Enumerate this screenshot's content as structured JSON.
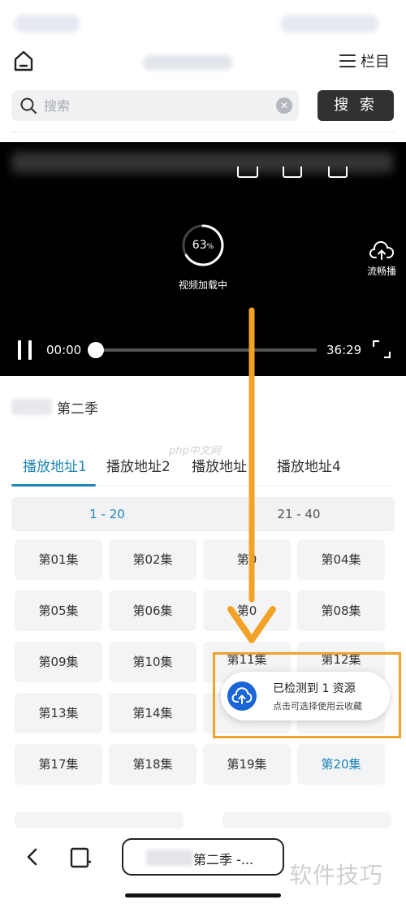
{
  "header": {
    "menu_label": "栏目"
  },
  "search": {
    "placeholder": "搜索",
    "button_label": "搜 索"
  },
  "player": {
    "progress_percent": "63",
    "percent_sign": "%",
    "loading_text": "视频加载中",
    "smooth_label": "流畅播",
    "current_time": "00:00",
    "total_time": "36:29"
  },
  "show": {
    "season": "第二季"
  },
  "source_tabs": [
    {
      "label": "播放地址1"
    },
    {
      "label": "播放地址2"
    },
    {
      "label": "播放地址"
    },
    {
      "label": "播放地址4"
    }
  ],
  "ranges": [
    {
      "label": "1 - 20"
    },
    {
      "label": "21 - 40"
    }
  ],
  "episodes": [
    {
      "label": "第01集"
    },
    {
      "label": "第02集"
    },
    {
      "label": "第0"
    },
    {
      "label": "第04集"
    },
    {
      "label": "第05集"
    },
    {
      "label": "第06集"
    },
    {
      "label": "第0"
    },
    {
      "label": "第08集"
    },
    {
      "label": "第09集"
    },
    {
      "label": "第10集"
    },
    {
      "label": "第11集"
    },
    {
      "label": "第12集"
    },
    {
      "label": "第13集"
    },
    {
      "label": "第14集"
    },
    {
      "label": ""
    },
    {
      "label": ""
    },
    {
      "label": "第17集"
    },
    {
      "label": "第18集"
    },
    {
      "label": "第19集"
    },
    {
      "label": "第20集"
    }
  ],
  "notice": {
    "title": "已检测到 1 资源",
    "subtitle": "点击可选择使用云收藏"
  },
  "bottom_nav": {
    "address_text": "第二季 -..."
  },
  "watermarks": {
    "php": "php中文网",
    "site": "软件技巧"
  },
  "colors": {
    "accent": "#1f86b8",
    "annotation": "#f2a327",
    "notice_icon": "#1b66d6"
  }
}
